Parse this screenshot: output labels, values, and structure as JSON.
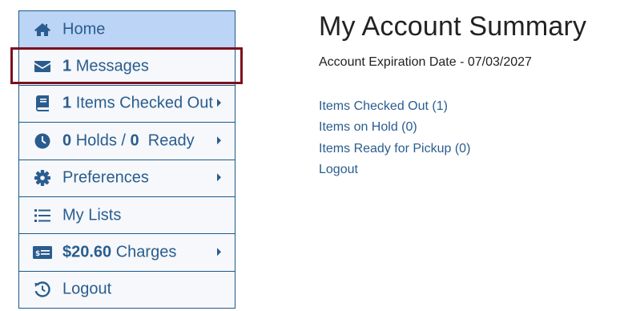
{
  "sidebar": {
    "items": [
      {
        "icon": "home-icon",
        "count": "",
        "label": "Home",
        "active": true,
        "caret": false
      },
      {
        "icon": "envelope-icon",
        "count": "1",
        "label": "Messages",
        "active": false,
        "caret": false
      },
      {
        "icon": "book-icon",
        "count": "1",
        "label": "Items Checked Out",
        "active": false,
        "caret": true
      },
      {
        "icon": "clock-icon",
        "count": "0",
        "label": "Holds /",
        "count2": "0",
        "label2": "Ready",
        "active": false,
        "caret": true
      },
      {
        "icon": "gear-icon",
        "count": "",
        "label": "Preferences",
        "active": false,
        "caret": true
      },
      {
        "icon": "list-icon",
        "count": "",
        "label": "My Lists",
        "active": false,
        "caret": false
      },
      {
        "icon": "money-icon",
        "count": "$20.60",
        "label": "Charges",
        "active": false,
        "caret": true
      },
      {
        "icon": "history-icon",
        "count": "",
        "label": "Logout",
        "active": false,
        "caret": false
      }
    ]
  },
  "main": {
    "title": "My Account Summary",
    "expiration": "Account Expiration Date - 07/03/2027",
    "links": [
      "Items Checked Out (1)",
      "Items on Hold (0)",
      "Items Ready for Pickup (0)",
      "Logout"
    ]
  },
  "colors": {
    "link": "#2a5d8f",
    "active_bg": "#bcd4f6",
    "highlight": "#7d1020"
  }
}
